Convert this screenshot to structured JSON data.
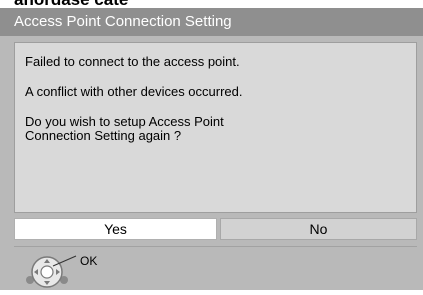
{
  "top_strip_text": "anordase cate",
  "dialog": {
    "title": "Access Point Connection Setting",
    "messages": [
      "Failed to connect to the access point.",
      "A conflict with other devices occurred.",
      "Do you wish to setup Access Point\nConnection Setting again ?"
    ],
    "buttons": {
      "yes": "Yes",
      "no": "No"
    },
    "footer": {
      "ok_label": "OK",
      "icon": "remote-dpad-icon"
    }
  },
  "colors": {
    "title_bar": "#8f8f8f",
    "dialog_bg": "#b9b9b9",
    "message_bg": "#d9d9d9",
    "yes_bg": "#ffffff",
    "no_bg": "#d2d2d2"
  }
}
